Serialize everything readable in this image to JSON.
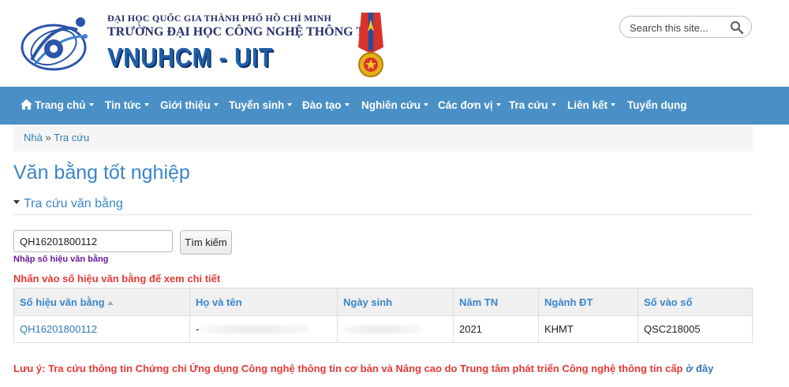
{
  "header": {
    "line1": "ĐẠI HỌC QUỐC GIA THÀNH PHỐ HỒ CHÍ MINH",
    "line2": "TRƯỜNG ĐẠI HỌC CÔNG NGHỆ THÔNG TIN",
    "line3": "VNUHCM - UIT"
  },
  "search": {
    "placeholder": "Search this site..."
  },
  "nav": {
    "items": [
      {
        "label": "Trang chủ",
        "icon": "home-icon",
        "dropdown": true
      },
      {
        "label": "Tin tức",
        "dropdown": true
      },
      {
        "label": "Giới thiệu",
        "dropdown": true
      },
      {
        "label": "Tuyển sinh",
        "dropdown": true
      },
      {
        "label": "Đào tạo",
        "dropdown": true
      },
      {
        "label": "Nghiên cứu",
        "dropdown": true
      },
      {
        "label": "Các đơn vị",
        "dropdown": true
      },
      {
        "label": "Tra cứu",
        "dropdown": true
      },
      {
        "label": "Liên kết",
        "dropdown": true
      },
      {
        "label": "Tuyển dụng",
        "dropdown": false
      }
    ]
  },
  "breadcrumb": {
    "home": "Nhà",
    "separator": "»",
    "current": "Tra cứu"
  },
  "page": {
    "title": "Văn bằng tốt nghiệp",
    "section": "Tra cứu văn bằng"
  },
  "form": {
    "query_value": "QH16201800112",
    "search_button": "Tìm kiếm",
    "hint": "Nhập số hiệu văn bằng",
    "instruction": "Nhấn vào số hiệu văn bằng để xem chi tiết"
  },
  "table": {
    "headers": [
      "Số hiệu văn bằng",
      "Họ và tên",
      "Ngày sinh",
      "Năm TN",
      "Ngành ĐT",
      "Số vào sổ"
    ],
    "rows": [
      [
        "QH16201800112",
        "-",
        "",
        "2021",
        "KHMT",
        "QSC218005"
      ]
    ]
  },
  "note": {
    "text": "Lưu ý: Tra cứu thông tin Chứng chỉ Ứng dụng Công nghệ thông tin cơ bản và Nâng cao do Trung tâm phát triển Công nghệ thông tin cấp",
    "link": "ở đây"
  },
  "colors": {
    "nav": "#4a90c6",
    "title": "#3a86c8",
    "alert": "#e53935",
    "link": "#337ab7"
  }
}
